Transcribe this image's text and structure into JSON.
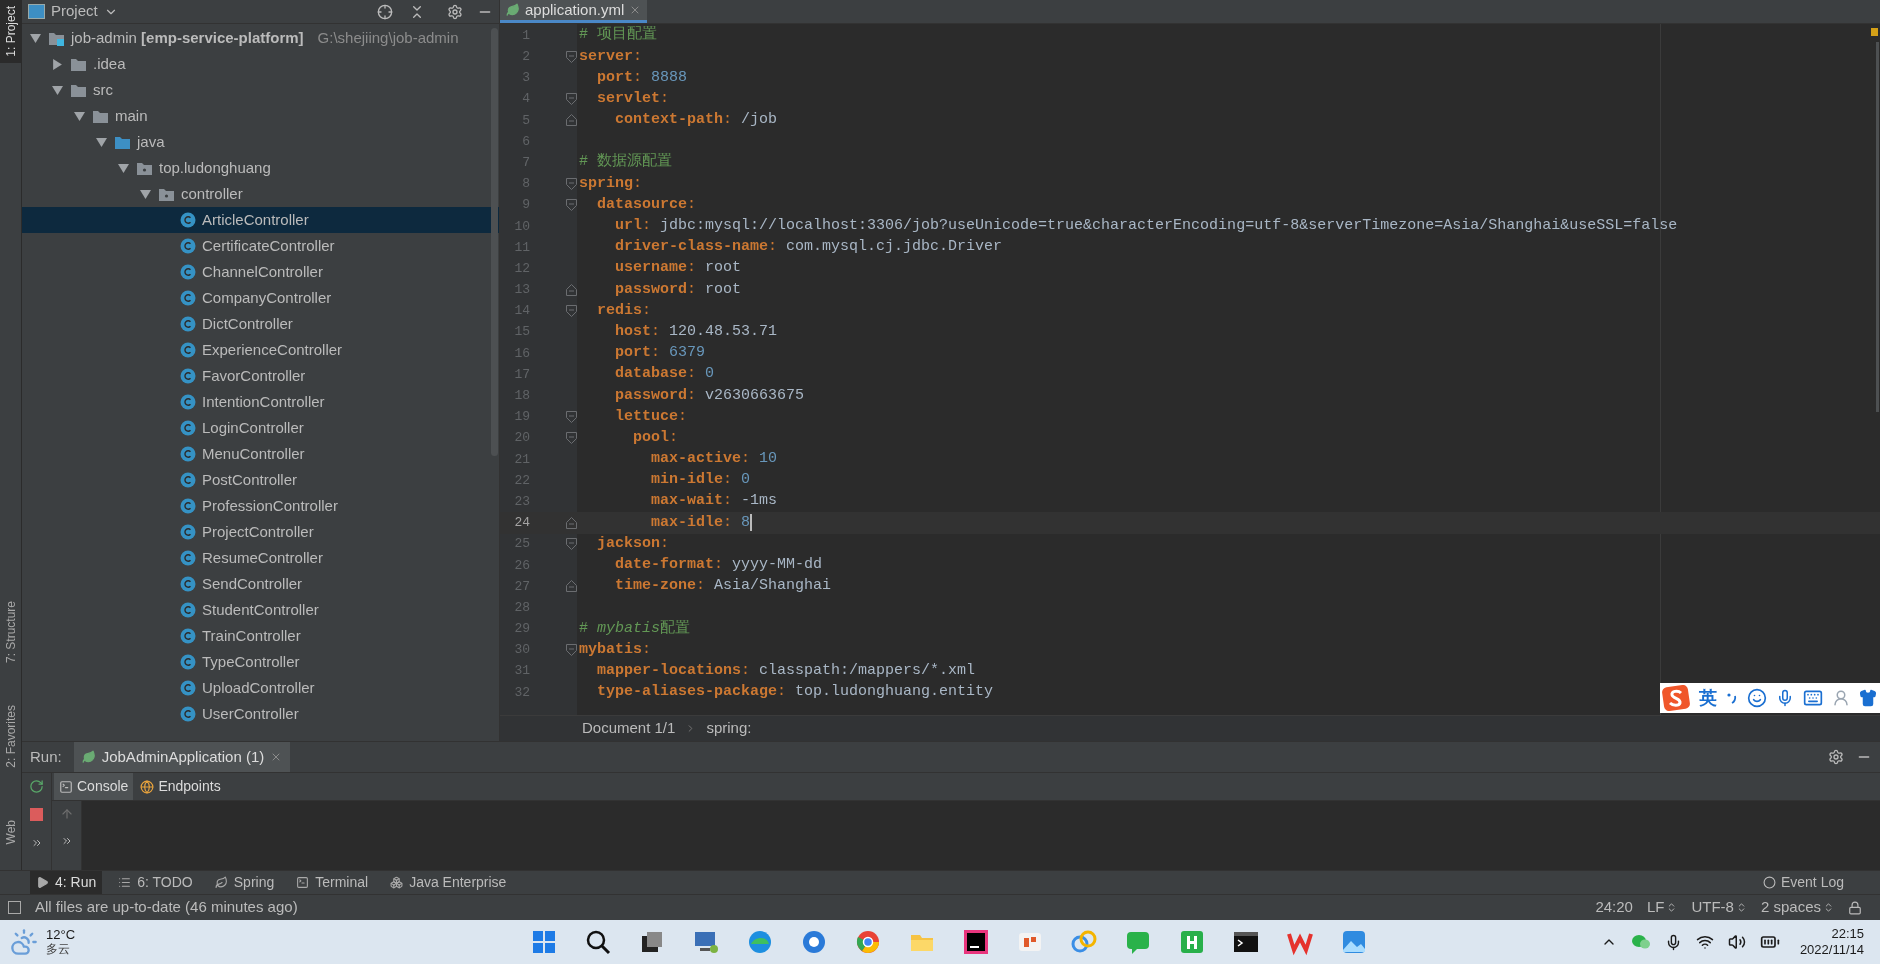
{
  "tool_strip": [
    {
      "label": "1: Project",
      "selected": true
    },
    {
      "label": "7: Structure",
      "selected": false
    },
    {
      "label": "2: Favorites",
      "selected": false
    },
    {
      "label": "Web",
      "selected": false
    }
  ],
  "project": {
    "title": "Project",
    "tree": [
      {
        "label": "job-admin **[emp-service-platform]**",
        "location": "G:\\shejiing\\job-admin",
        "kind": "module",
        "expanded": true,
        "selected": false,
        "children": [
          {
            "label": ".idea",
            "kind": "folder",
            "expanded": false,
            "selected": false
          },
          {
            "label": "src",
            "kind": "folder",
            "expanded": true,
            "selected": false,
            "children": [
              {
                "label": "main",
                "kind": "folder",
                "expanded": true,
                "selected": false,
                "children": [
                  {
                    "label": "java",
                    "kind": "source-folder",
                    "expanded": true,
                    "selected": false,
                    "children": [
                      {
                        "label": "top.ludonghuang",
                        "kind": "package",
                        "expanded": true,
                        "selected": false,
                        "children": [
                          {
                            "label": "controller",
                            "kind": "package",
                            "expanded": true,
                            "selected": false,
                            "children": [
                              {
                                "label": "ArticleController",
                                "kind": "class",
                                "selected": true
                              },
                              {
                                "label": "CertificateController",
                                "kind": "class",
                                "selected": false
                              },
                              {
                                "label": "ChannelController",
                                "kind": "class",
                                "selected": false
                              },
                              {
                                "label": "CompanyController",
                                "kind": "class",
                                "selected": false
                              },
                              {
                                "label": "DictController",
                                "kind": "class",
                                "selected": false
                              },
                              {
                                "label": "ExperienceController",
                                "kind": "class",
                                "selected": false
                              },
                              {
                                "label": "FavorController",
                                "kind": "class",
                                "selected": false
                              },
                              {
                                "label": "IntentionController",
                                "kind": "class",
                                "selected": false
                              },
                              {
                                "label": "LoginController",
                                "kind": "class",
                                "selected": false
                              },
                              {
                                "label": "MenuController",
                                "kind": "class",
                                "selected": false
                              },
                              {
                                "label": "PostController",
                                "kind": "class",
                                "selected": false
                              },
                              {
                                "label": "ProfessionController",
                                "kind": "class",
                                "selected": false
                              },
                              {
                                "label": "ProjectController",
                                "kind": "class",
                                "selected": false
                              },
                              {
                                "label": "ResumeController",
                                "kind": "class",
                                "selected": false
                              },
                              {
                                "label": "SendController",
                                "kind": "class",
                                "selected": false
                              },
                              {
                                "label": "StudentController",
                                "kind": "class",
                                "selected": false
                              },
                              {
                                "label": "TrainController",
                                "kind": "class",
                                "selected": false
                              },
                              {
                                "label": "TypeController",
                                "kind": "class",
                                "selected": false
                              },
                              {
                                "label": "UploadController",
                                "kind": "class",
                                "selected": false
                              },
                              {
                                "label": "UserController",
                                "kind": "class",
                                "selected": false
                              }
                            ]
                          }
                        ]
                      }
                    ]
                  }
                ]
              }
            ]
          }
        ]
      }
    ]
  },
  "editor": {
    "tab": {
      "label": "application.yml",
      "selected": true
    },
    "lines": [
      {
        "number": "1",
        "current": false,
        "tokens": [
          {
            "kind": "comment",
            "text": "# 项目配置"
          }
        ]
      },
      {
        "number": "2",
        "current": false,
        "tokens": [
          {
            "kind": "key",
            "text": "server"
          },
          {
            "kind": "punct",
            "text": ":"
          }
        ],
        "children": [
          {
            "number": "3",
            "current": false,
            "tokens": [
              {
                "kind": "key",
                "text": "port"
              },
              {
                "kind": "punct",
                "text": ": "
              },
              {
                "kind": "number",
                "text": "8888"
              }
            ]
          },
          {
            "number": "4",
            "current": false,
            "tokens": [
              {
                "kind": "key",
                "text": "servlet"
              },
              {
                "kind": "punct",
                "text": ":"
              }
            ],
            "children": [
              {
                "number": "5",
                "current": false,
                "tokens": [
                  {
                    "kind": "key",
                    "text": "context-path"
                  },
                  {
                    "kind": "punct",
                    "text": ": "
                  },
                  {
                    "kind": "text",
                    "text": "/job"
                  }
                ]
              }
            ]
          }
        ]
      },
      {
        "number": "6",
        "current": false
      },
      {
        "number": "7",
        "current": false,
        "tokens": [
          {
            "kind": "comment",
            "text": "# 数据源配置"
          }
        ]
      },
      {
        "number": "8",
        "current": false,
        "tokens": [
          {
            "kind": "key",
            "text": "spring"
          },
          {
            "kind": "punct",
            "text": ":"
          }
        ],
        "children": [
          {
            "number": "9",
            "current": false,
            "tokens": [
              {
                "kind": "key",
                "text": "datasource"
              },
              {
                "kind": "punct",
                "text": ":"
              }
            ],
            "children": [
              {
                "number": "10",
                "current": false,
                "tokens": [
                  {
                    "kind": "key",
                    "text": "url"
                  },
                  {
                    "kind": "punct",
                    "text": ": "
                  },
                  {
                    "kind": "text",
                    "text": "jdbc:mysql://localhost:3306/job?useUnicode=true&characterEncoding=utf-8&serverTimezone=Asia/Shanghai&useSSL=false"
                  }
                ]
              },
              {
                "number": "11",
                "current": false,
                "tokens": [
                  {
                    "kind": "key",
                    "text": "driver-class-name"
                  },
                  {
                    "kind": "punct",
                    "text": ": "
                  },
                  {
                    "kind": "text",
                    "text": "com.mysql.cj.jdbc.Driver"
                  }
                ]
              },
              {
                "number": "12",
                "current": false,
                "tokens": [
                  {
                    "kind": "key",
                    "text": "username"
                  },
                  {
                    "kind": "punct",
                    "text": ": "
                  },
                  {
                    "kind": "text",
                    "text": "root"
                  }
                ]
              },
              {
                "number": "13",
                "current": false,
                "tokens": [
                  {
                    "kind": "key",
                    "text": "password"
                  },
                  {
                    "kind": "punct",
                    "text": ": "
                  },
                  {
                    "kind": "text",
                    "text": "root"
                  }
                ]
              }
            ]
          },
          {
            "number": "14",
            "current": false,
            "tokens": [
              {
                "kind": "key",
                "text": "redis"
              },
              {
                "kind": "punct",
                "text": ":"
              }
            ],
            "children": [
              {
                "number": "15",
                "current": false,
                "tokens": [
                  {
                    "kind": "key",
                    "text": "host"
                  },
                  {
                    "kind": "punct",
                    "text": ": "
                  },
                  {
                    "kind": "text",
                    "text": "120.48.53.71"
                  }
                ]
              },
              {
                "number": "16",
                "current": false,
                "tokens": [
                  {
                    "kind": "key",
                    "text": "port"
                  },
                  {
                    "kind": "punct",
                    "text": ": "
                  },
                  {
                    "kind": "number",
                    "text": "6379"
                  }
                ]
              },
              {
                "number": "17",
                "current": false,
                "tokens": [
                  {
                    "kind": "key",
                    "text": "database"
                  },
                  {
                    "kind": "punct",
                    "text": ": "
                  },
                  {
                    "kind": "number",
                    "text": "0"
                  }
                ]
              },
              {
                "number": "18",
                "current": false,
                "tokens": [
                  {
                    "kind": "key",
                    "text": "password"
                  },
                  {
                    "kind": "punct",
                    "text": ": "
                  },
                  {
                    "kind": "text",
                    "text": "v2630663675"
                  }
                ]
              },
              {
                "number": "19",
                "current": false,
                "tokens": [
                  {
                    "kind": "key",
                    "text": "lettuce"
                  },
                  {
                    "kind": "punct",
                    "text": ":"
                  }
                ],
                "children": [
                  {
                    "number": "20",
                    "current": false,
                    "tokens": [
                      {
                        "kind": "key",
                        "text": "pool"
                      },
                      {
                        "kind": "punct",
                        "text": ":"
                      }
                    ],
                    "children": [
                      {
                        "number": "21",
                        "current": false,
                        "tokens": [
                          {
                            "kind": "key",
                            "text": "max-active"
                          },
                          {
                            "kind": "punct",
                            "text": ": "
                          },
                          {
                            "kind": "number",
                            "text": "10"
                          }
                        ]
                      },
                      {
                        "number": "22",
                        "current": false,
                        "tokens": [
                          {
                            "kind": "key",
                            "text": "min-idle"
                          },
                          {
                            "kind": "punct",
                            "text": ": "
                          },
                          {
                            "kind": "number",
                            "text": "0"
                          }
                        ]
                      },
                      {
                        "number": "23",
                        "current": false,
                        "tokens": [
                          {
                            "kind": "key",
                            "text": "max-wait"
                          },
                          {
                            "kind": "punct",
                            "text": ": "
                          },
                          {
                            "kind": "text",
                            "text": "-1ms"
                          }
                        ]
                      },
                      {
                        "number": "24",
                        "current": true,
                        "tokens": [
                          {
                            "kind": "key",
                            "text": "max-idle"
                          },
                          {
                            "kind": "punct",
                            "text": ": "
                          },
                          {
                            "kind": "number",
                            "text": "8"
                          }
                        ]
                      }
                    ]
                  }
                ]
              }
            ]
          },
          {
            "number": "25",
            "current": false,
            "tokens": [
              {
                "kind": "key",
                "text": "jackson"
              },
              {
                "kind": "punct",
                "text": ":"
              }
            ],
            "children": [
              {
                "number": "26",
                "current": false,
                "tokens": [
                  {
                    "kind": "key",
                    "text": "date-format"
                  },
                  {
                    "kind": "punct",
                    "text": ": "
                  },
                  {
                    "kind": "text",
                    "text": "yyyy-MM-dd"
                  }
                ]
              },
              {
                "number": "27",
                "current": false,
                "tokens": [
                  {
                    "kind": "key",
                    "text": "time-zone"
                  },
                  {
                    "kind": "punct",
                    "text": ": "
                  },
                  {
                    "kind": "text",
                    "text": "Asia/Shanghai"
                  }
                ]
              }
            ]
          }
        ]
      },
      {
        "number": "28",
        "current": false
      },
      {
        "number": "29",
        "current": false,
        "tokens": [
          {
            "kind": "comment",
            "text": "#"
          },
          {
            "kind": "comment-italic",
            "text": "mybatis"
          },
          {
            "kind": "comment",
            "text": "配置"
          }
        ]
      },
      {
        "number": "30",
        "current": false,
        "tokens": [
          {
            "kind": "key",
            "text": "mybatis"
          },
          {
            "kind": "punct",
            "text": ":"
          }
        ],
        "children": [
          {
            "number": "31",
            "current": false,
            "tokens": [
              {
                "kind": "key",
                "text": "mapper-locations"
              },
              {
                "kind": "punct",
                "text": ": "
              },
              {
                "kind": "text",
                "text": "classpath:/mappers/*.xml"
              }
            ]
          },
          {
            "number": "32",
            "current": false,
            "tokens": [
              {
                "kind": "key",
                "text": "type-aliases-package"
              },
              {
                "kind": "punct",
                "text": ": "
              },
              {
                "kind": "text",
                "text": "top.ludonghuang.entity"
              }
            ]
          }
        ]
      }
    ],
    "breadcrumbs": [
      "Document 1/1",
      "spring:"
    ]
  },
  "ime_bar": {
    "mode": "英"
  },
  "run": {
    "label": "Run:",
    "tab": "JobAdminApplication (1)",
    "tabs": [
      {
        "label": "Console",
        "kind": "console",
        "selected": true
      },
      {
        "label": "Endpoints",
        "kind": "endpoints",
        "selected": false
      }
    ]
  },
  "tool_windows": [
    {
      "label": "4: Run",
      "kind": "run",
      "selected": true
    },
    {
      "label": "6: TODO",
      "kind": "todo",
      "selected": false
    },
    {
      "label": "Spring",
      "kind": "spring",
      "selected": false
    },
    {
      "label": "Terminal",
      "kind": "terminal",
      "selected": false
    },
    {
      "label": "Java Enterprise",
      "kind": "enterprise",
      "selected": false
    }
  ],
  "event_log": "Event Log",
  "status_bar": {
    "message": "All files are up-to-date (46 minutes ago)",
    "items": [
      {
        "text": "24:20",
        "dropdown": false
      },
      {
        "text": "LF",
        "dropdown": true
      },
      {
        "text": "UTF-8",
        "dropdown": true
      },
      {
        "text": "2 spaces",
        "dropdown": true
      }
    ]
  },
  "taskbar": {
    "weather": {
      "temperature": "12°C",
      "condition": "多云"
    },
    "clock": {
      "time": "22:15",
      "date": "2022/11/14"
    }
  }
}
